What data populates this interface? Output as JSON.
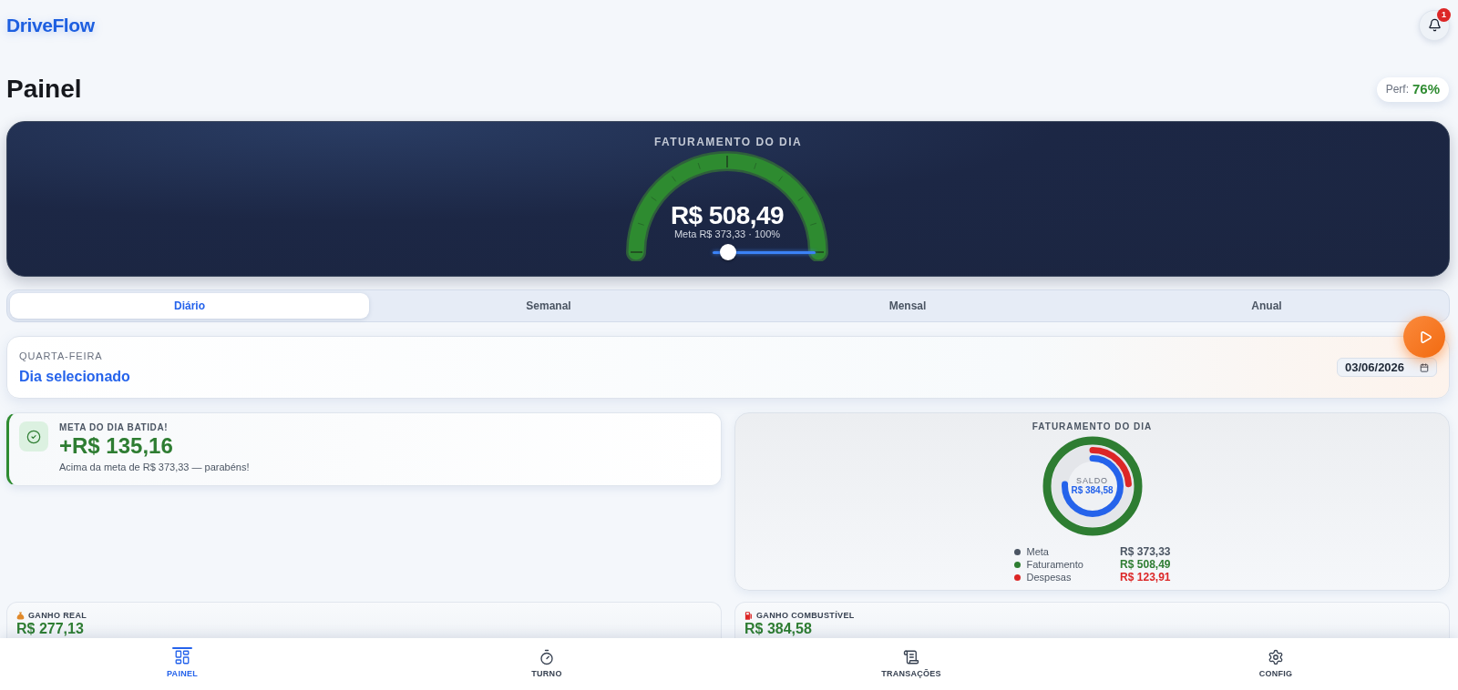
{
  "header": {
    "logo": "DriveFlow",
    "notifications": {
      "count": "1"
    }
  },
  "page": {
    "title": "Painel",
    "perf": {
      "label": "Perf:",
      "value": "76%"
    }
  },
  "hero": {
    "title": "FATURAMENTO DO DIA",
    "value": "R$ 508,49",
    "subtitle": "Meta R$ 373,33 · 100%",
    "gauge": {
      "level": 1
    },
    "slider": {
      "level": 0.15
    }
  },
  "periods": [
    {
      "label": "Diário",
      "selected": true
    },
    {
      "label": "Semanal",
      "selected": false
    },
    {
      "label": "Mensal",
      "selected": false
    },
    {
      "label": "Anual",
      "selected": false
    }
  ],
  "day": {
    "weekday": "QUARTA-FEIRA",
    "title": "Dia selecionado",
    "date": "03/06/2026"
  },
  "goal_card": {
    "title": "META DO DIA BATIDA!",
    "amount": "+R$ 135,16",
    "message": "Acima da meta de R$ 373,33 — parabéns!"
  },
  "revenue_chart": {
    "title": "FATURAMENTO DO DIA",
    "center_label": "SALDO",
    "center_value": "R$ 384,58",
    "rings": [
      {
        "level": 1,
        "color": "#2e7d32"
      },
      {
        "level": 0.24,
        "color": "#dc2626"
      },
      {
        "level": 0.76,
        "color": "#2563eb"
      }
    ],
    "legend": [
      {
        "label": "Meta",
        "value": "R$ 373,33",
        "color": "#4b5563"
      },
      {
        "label": "Faturamento",
        "value": "R$ 508,49",
        "color": "#2e7d32"
      },
      {
        "label": "Despesas",
        "value": "R$ 123,91",
        "color": "#dc2626"
      }
    ]
  },
  "summary_cards": [
    {
      "kind": "earnings",
      "title": "GANHO REAL",
      "value": "R$ 277,13"
    },
    {
      "kind": "fuel",
      "title": "GANHO COMBUSTÍVEL",
      "value": "R$ 384,58"
    }
  ],
  "nav": [
    {
      "kind": "dashboard",
      "label": "PAINEL",
      "selected": true
    },
    {
      "kind": "timer",
      "label": "TURNO",
      "selected": false
    },
    {
      "kind": "receipt",
      "label": "TRANSAÇÕES",
      "selected": false
    },
    {
      "kind": "settings",
      "label": "CONFIG",
      "selected": false
    }
  ]
}
